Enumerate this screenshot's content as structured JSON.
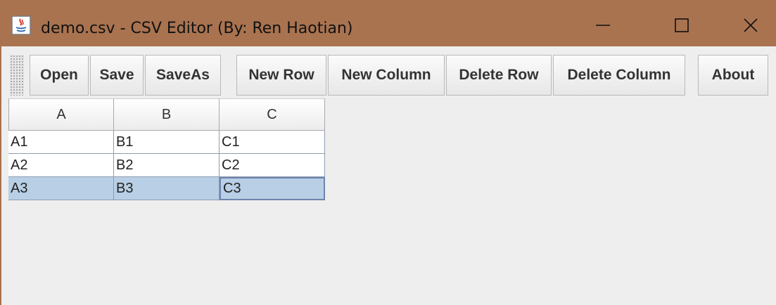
{
  "window": {
    "title": "demo.csv - CSV Editor (By: Ren Haotian)",
    "controls": {
      "minimize": "—",
      "maximize": "☐",
      "close": "✕"
    },
    "app_icon": "java-app-icon"
  },
  "toolbar": {
    "buttons": [
      {
        "label": "Open"
      },
      {
        "label": "Save"
      },
      {
        "label": "SaveAs"
      },
      {
        "label": "New Row"
      },
      {
        "label": "New Column"
      },
      {
        "label": "Delete Row"
      },
      {
        "label": "Delete Column"
      },
      {
        "label": "About"
      }
    ]
  },
  "table": {
    "columns": [
      "A",
      "B",
      "C"
    ],
    "rows": [
      [
        "A1",
        "B1",
        "C1"
      ],
      [
        "A2",
        "B2",
        "C2"
      ],
      [
        "A3",
        "B3",
        "C3"
      ]
    ],
    "selected_row": 2,
    "focused_cell": {
      "row": 2,
      "col": 2
    }
  },
  "colors": {
    "titlebar": "#a97350",
    "selection": "#b8cfe5",
    "background": "#eeeeee"
  }
}
